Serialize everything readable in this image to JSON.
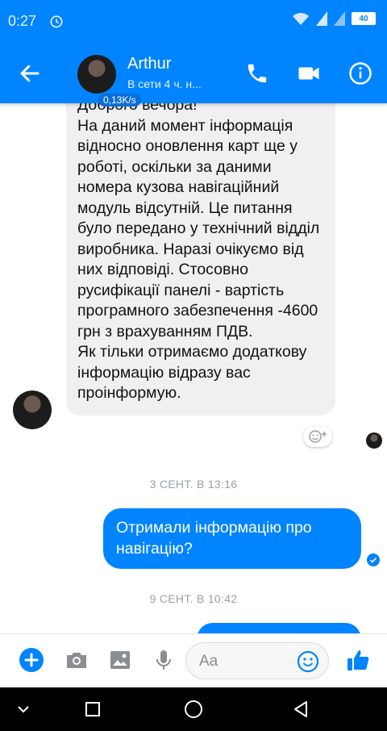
{
  "status_bar": {
    "time": "0:27",
    "battery": "40"
  },
  "header": {
    "contact_name": "Arthur",
    "contact_status": "В сети 4 ч. н...",
    "network_speed": "0,13K/s"
  },
  "messages": {
    "incoming": "Доброго вечора!\nНа даний момент інформація відносно оновлення карт ще у роботі, оскільки за даними номера кузова навігаційний модуль відсутній. Це питання було передано у технічний відділ виробника. Наразі очікуємо від них відповіді. Стосовно русифікації панелі - вартість програмного забезпечення -4600 грн з врахуванням ПДВ.\nЯк тільки отримаємо додаткову інформацію відразу вас проінформую.",
    "timestamp_1": "3 СЕНТ. В 13:16",
    "outgoing": "Отримали інформацію про навігацію?",
    "timestamp_2": "9 СЕНТ. В 10:42"
  },
  "composer": {
    "placeholder": "Aa"
  },
  "colors": {
    "brand": "#0084ff",
    "bubble_in": "#f1f0f0"
  },
  "icons": [
    "back-arrow-icon",
    "phone-icon",
    "video-camera-icon",
    "info-icon",
    "add-icon",
    "camera-icon",
    "gallery-icon",
    "microphone-icon",
    "emoji-icon",
    "thumbs-up-icon",
    "add-reaction-icon",
    "nav-back-icon",
    "nav-home-icon",
    "nav-recents-icon",
    "nav-collapse-icon"
  ]
}
